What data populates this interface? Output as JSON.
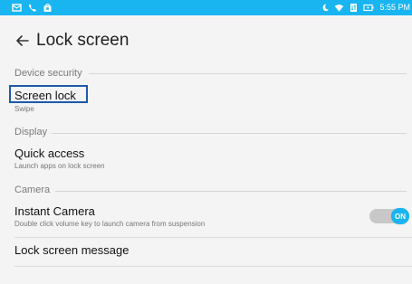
{
  "status_bar": {
    "time": "5:55 PM",
    "background": "#19b5f1"
  },
  "toolbar": {
    "title": "Lock screen",
    "back_icon": "arrow-back-icon"
  },
  "sections": {
    "device_security": {
      "header": "Device security",
      "screen_lock": {
        "title": "Screen lock",
        "summary": "Swipe"
      }
    },
    "display": {
      "header": "Display",
      "quick_access": {
        "title": "Quick access",
        "summary": "Launch apps on lock screen"
      }
    },
    "camera": {
      "header": "Camera",
      "instant_camera": {
        "title": "Instant Camera",
        "summary": "Double click volume key to launch camera from suspension",
        "toggle_label": "ON",
        "toggle_state": "on"
      }
    },
    "lock_screen_message": {
      "title": "Lock screen message"
    }
  },
  "colors": {
    "accent": "#19b5f1",
    "highlight_border": "#1e5aa8"
  }
}
